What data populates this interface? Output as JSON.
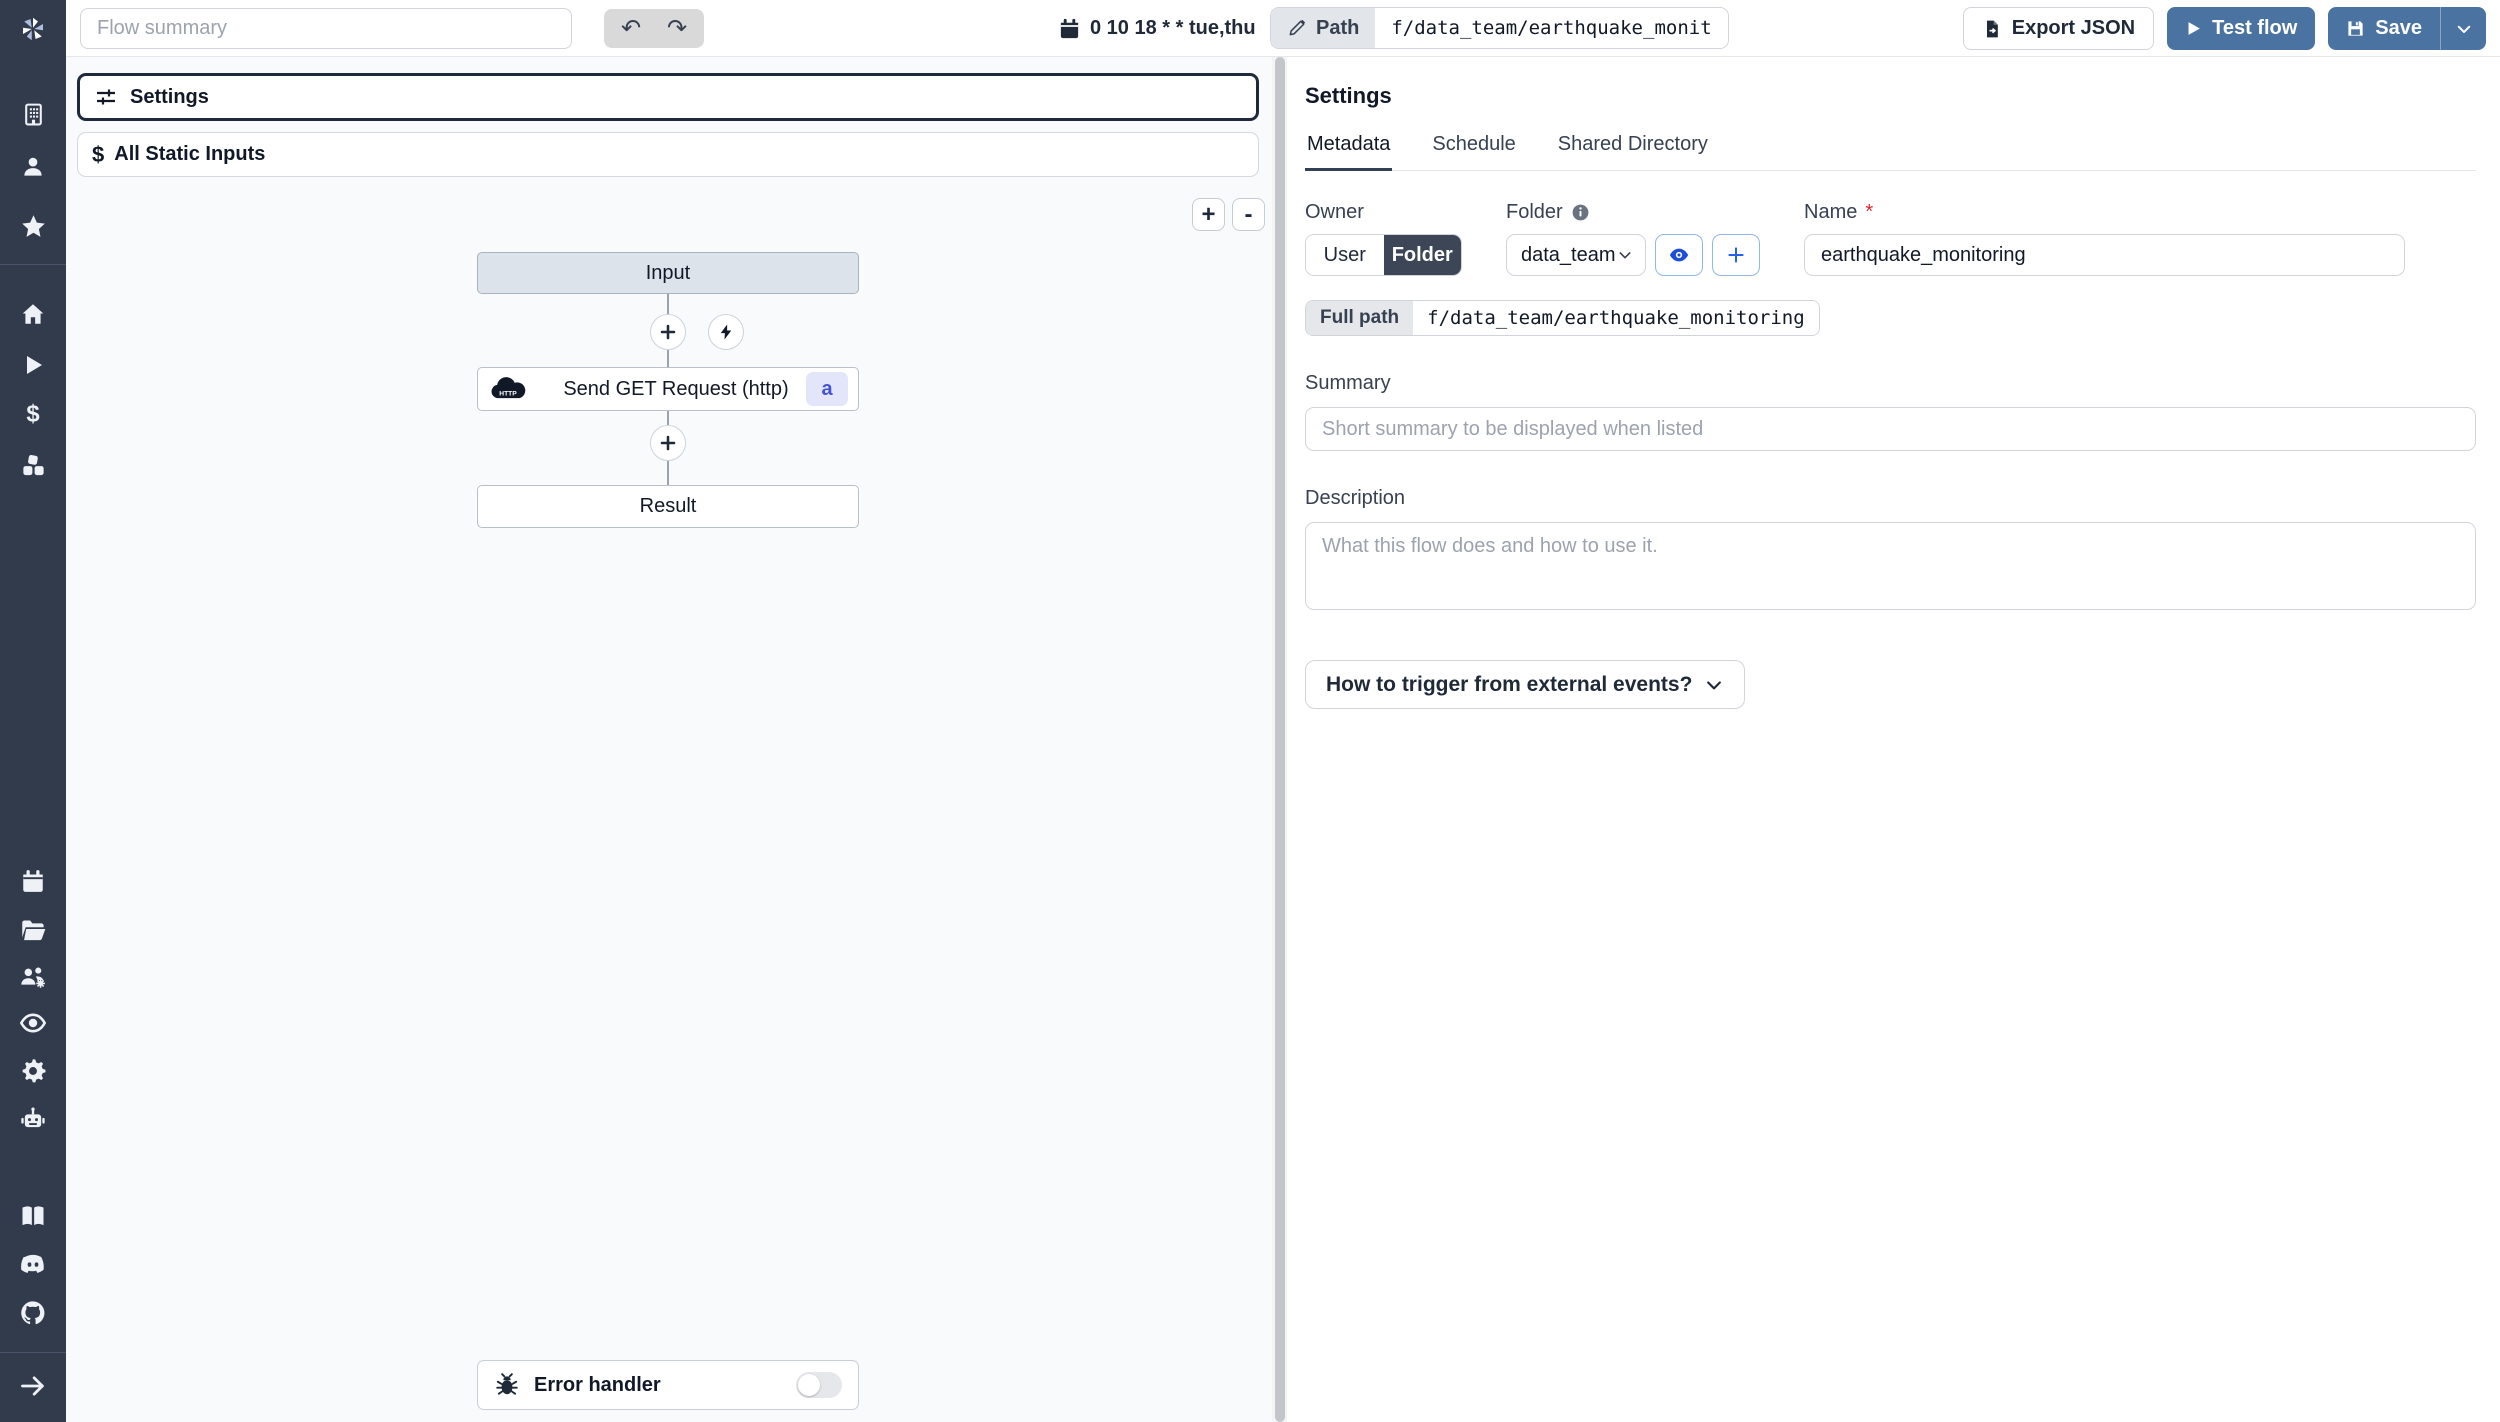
{
  "topbar": {
    "flow_summary_placeholder": "Flow summary",
    "undo_label": "↶",
    "redo_label": "↷",
    "schedule": "0 10 18 * * tue,thu",
    "path_label": "Path",
    "path_value": "f/data_team/earthquake_monit",
    "export_json_label": "Export JSON",
    "test_flow_label": "Test flow",
    "save_label": "Save"
  },
  "flow_panel": {
    "settings_label": "Settings",
    "static_inputs_label": "All Static Inputs",
    "static_inputs_icon": "$",
    "zoom_in_label": "+",
    "zoom_out_label": "-",
    "nodes": {
      "input_label": "Input",
      "http_label": "Send GET Request (http)",
      "http_badge": "a",
      "result_label": "Result",
      "error_handler_label": "Error handler"
    }
  },
  "right_panel": {
    "title": "Settings",
    "tabs": [
      "Metadata",
      "Schedule",
      "Shared Directory"
    ],
    "owner": {
      "label": "Owner",
      "user_option": "User",
      "folder_option": "Folder"
    },
    "folder": {
      "label": "Folder",
      "selected_value": "data_team"
    },
    "name": {
      "label": "Name",
      "required_mark": "*",
      "value": "earthquake_monitoring"
    },
    "full_path": {
      "label": "Full path",
      "value": "f/data_team/earthquake_monitoring"
    },
    "summary": {
      "label": "Summary",
      "placeholder": "Short summary to be displayed when listed"
    },
    "description": {
      "label": "Description",
      "placeholder": "What this flow does and how to use it."
    },
    "trigger_button_label": "How to trigger from external events?"
  },
  "sidebar_icons": [
    "windmill-logo",
    "building",
    "user",
    "star",
    "home",
    "play",
    "dollar",
    "cubes",
    "calendar",
    "folder-open",
    "users-gear",
    "eye",
    "gear",
    "robot",
    "book",
    "discord",
    "github",
    "arrow-right"
  ],
  "colors": {
    "sidebar_bg": "#323b4c",
    "accent_blue": "#4a73a2",
    "selected_segment": "#3c4656",
    "node_input_fill": "#dde3ea",
    "http_badge_bg": "#e3e6fb",
    "http_badge_text": "#4653cf",
    "canvas_bg": "#f8fafc"
  }
}
